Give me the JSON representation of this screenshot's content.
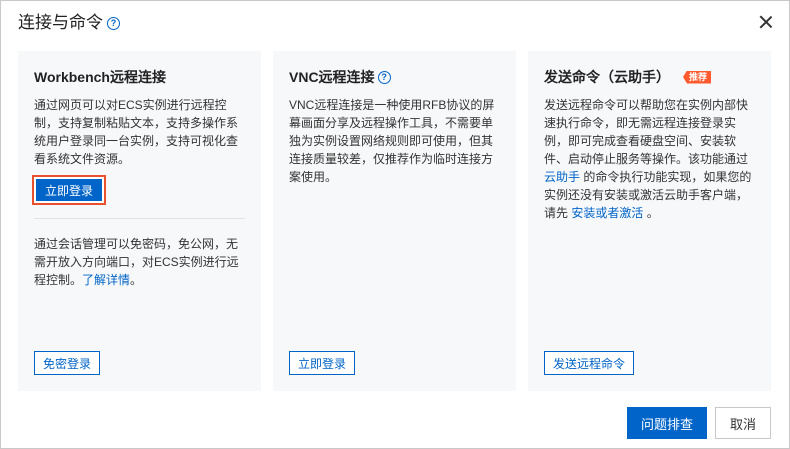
{
  "dialog": {
    "title": "连接与命令",
    "help_icon": "help-circle-icon",
    "close_icon": "close-icon"
  },
  "cards": [
    {
      "title": "Workbench远程连接",
      "desc": "通过网页可以对ECS实例进行远程控制，支持复制粘贴文本，支持多操作系统用户登录同一台实例，支持可视化查看系统文件资源。",
      "primary_button": "立即登录",
      "desc2_before": "通过会话管理可以免密码，免公网，无需开放入方向端口，对ECS实例进行远程控制。",
      "desc2_link": "了解详情",
      "desc2_after": "。",
      "footer_button": "免密登录"
    },
    {
      "title": "VNC远程连接",
      "desc": "VNC远程连接是一种使用RFB协议的屏幕画面分享及远程操作工具，不需要单独为实例设置网络规则即可使用，但其连接质量较差，仅推荐作为临时连接方案使用。",
      "footer_button": "立即登录"
    },
    {
      "title": "发送命令（云助手）",
      "badge": "推荐",
      "desc_part1": "发送远程命令可以帮助您在实例内部快速执行命令，即无需远程连接登录实例，即可完成查看硬盘空间、安装软件、启动停止服务等操作。该功能通过",
      "desc_link1": "云助手",
      "desc_part2": " 的命令执行功能实现，如果您的实例还没有安装或激活云助手客户端，请先 ",
      "desc_link2": "安装或者激活",
      "desc_part3": " 。",
      "footer_button": "发送远程命令"
    }
  ],
  "footer": {
    "troubleshoot": "问题排查",
    "cancel": "取消"
  },
  "colors": {
    "primary": "#0064c8",
    "badge": "#ff5a2e",
    "card_bg": "#f7f8fa"
  }
}
